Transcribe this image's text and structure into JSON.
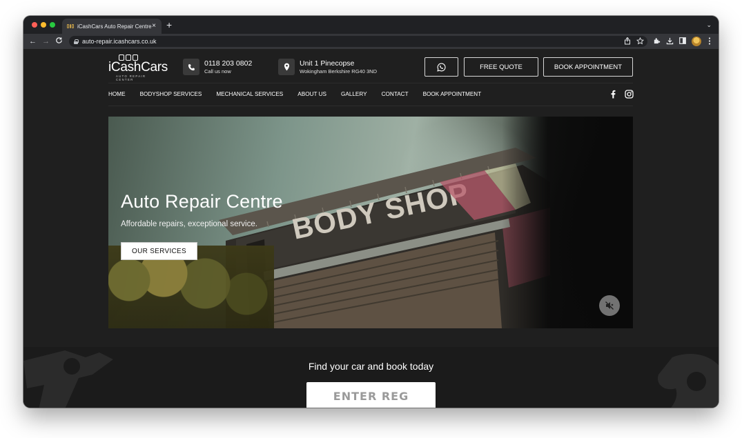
{
  "browser": {
    "tab_title": "iCashCars Auto Repair Centre",
    "tab_close": "×",
    "new_tab": "+",
    "tab_menu": "⌄",
    "url": "auto-repair.icashcars.co.uk",
    "nav_back": "←",
    "nav_forward": "→",
    "nav_reload": "C",
    "toolbar_icons": [
      "share-icon",
      "star-icon",
      "extensions-icon",
      "download-icon",
      "sidepanel-icon",
      "profile-avatar",
      "menu-icon"
    ]
  },
  "header": {
    "logo_word": "iCashCars",
    "logo_sub": "AUTO REPAIR CENTER",
    "phone": {
      "number": "0118 203 0802",
      "label": "Call us now"
    },
    "address": {
      "line1": "Unit 1 Pinecopse",
      "line2": "Wokingham Berkshire RG40 3ND"
    },
    "buttons": {
      "free_quote": "FREE QUOTE",
      "book": "BOOK APPOINTMENT"
    }
  },
  "nav": {
    "items": [
      "HOME",
      "BODYSHOP SERVICES",
      "MECHANICAL SERVICES",
      "ABOUT US",
      "GALLERY",
      "CONTACT",
      "BOOK APPOINTMENT"
    ],
    "social": [
      "facebook-icon",
      "instagram-icon"
    ]
  },
  "hero": {
    "title": "Auto Repair Centre",
    "subtitle": "Affordable repairs, exceptional service.",
    "button": "OUR SERVICES",
    "sign_text": "BODY SHOP"
  },
  "find": {
    "title": "Find your car and book today",
    "reg_placeholder": "ENTER REG"
  },
  "colors": {
    "page_bg": "#1f1f1f",
    "text": "#ffffff",
    "browser_chrome": "#35363a",
    "tabstrip": "#202124"
  }
}
